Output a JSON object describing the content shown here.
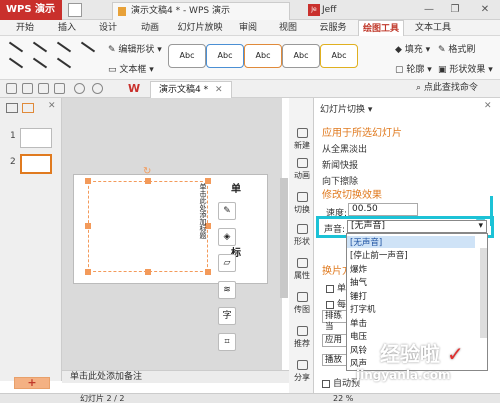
{
  "titlebar": {
    "app_button": "WPS 演示",
    "doc_tab": "演示文稿4 * - WPS 演示",
    "user": "Jeff",
    "user_avatar": "Je",
    "window_controls": [
      "—",
      "❐",
      "✕"
    ]
  },
  "menu": {
    "items": [
      "开始",
      "插入",
      "设计",
      "动画",
      "幻灯片放映",
      "审阅",
      "视图",
      "云服务",
      "绘图工具",
      "文本工具"
    ],
    "active": "绘图工具"
  },
  "ribbon": {
    "edit_shape": "编辑形状",
    "textbox": "文本框",
    "styles": [
      "Abc",
      "Abc",
      "Abc",
      "Abc",
      "Abc"
    ],
    "fill": "填充",
    "format_painter": "格式刷",
    "outline": "轮廓",
    "shape_effects": "形状效果"
  },
  "toolbar2": {
    "doc_tab": "演示文稿4 *",
    "search": "点此查找命令"
  },
  "left_pane": {
    "slides": [
      "1",
      "2"
    ],
    "add_button": "+"
  },
  "notes": {
    "placeholder": "单击此处添加备注"
  },
  "slide": {
    "vertical_text": "单击此处添加标题",
    "side_glyphs": [
      "单",
      "标"
    ]
  },
  "sidebar": {
    "items": [
      "新建",
      "动画",
      "切换",
      "形状",
      "属性",
      "传图",
      "推荐",
      "分享"
    ]
  },
  "panel": {
    "header": "幻灯片切换 ▾",
    "section1": "应用于所选幻灯片",
    "transitions": [
      "从全黑淡出",
      "新闻快报",
      "向下擦除"
    ],
    "section2": "修改切换效果",
    "speed_label": "速度:",
    "speed_value": "00.50",
    "sound_label": "声音:",
    "sound_value": "[无声音]",
    "section3": "换片方",
    "check1": "单击",
    "check2": "每",
    "apply_all": "排练当",
    "apply_btn": "应用",
    "play": "播放",
    "autopreview": "自动预"
  },
  "dropdown": {
    "options": [
      "[无声音]",
      "[停止前一声音]",
      "爆炸",
      "抽气",
      "锤打",
      "打字机",
      "单击",
      "电压",
      "风铃",
      "风声"
    ],
    "selected": "[无声音]"
  },
  "statusbar": {
    "slide_count": "幻灯片 2 / 2",
    "zoom": "22 %"
  },
  "watermark": {
    "line1": "经验啦",
    "line2": "jingyanla.com"
  },
  "colors": {
    "wps_red": "#c9302c",
    "section_orange": "#e07a1f",
    "highlight_teal": "#1cc2d6",
    "handle_orange": "#f39a5a"
  }
}
